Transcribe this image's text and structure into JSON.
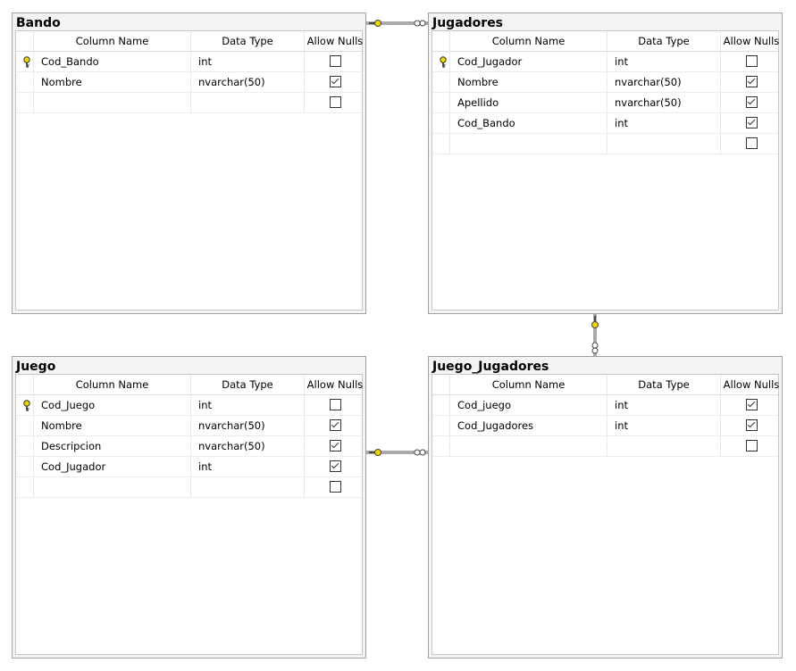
{
  "headers": {
    "col_name": "Column Name",
    "data_type": "Data Type",
    "allow_nulls": "Allow Nulls"
  },
  "tables": [
    {
      "title": "Bando",
      "rows": [
        {
          "pk": true,
          "name": "Cod_Bando",
          "type": "int",
          "nulls": false
        },
        {
          "pk": false,
          "name": "Nombre",
          "type": "nvarchar(50)",
          "nulls": true
        },
        {
          "pk": false,
          "name": "",
          "type": "",
          "nulls": false
        }
      ]
    },
    {
      "title": "Jugadores",
      "rows": [
        {
          "pk": true,
          "name": "Cod_Jugador",
          "type": "int",
          "nulls": false
        },
        {
          "pk": false,
          "name": "Nombre",
          "type": "nvarchar(50)",
          "nulls": true
        },
        {
          "pk": false,
          "name": "Apellido",
          "type": "nvarchar(50)",
          "nulls": true
        },
        {
          "pk": false,
          "name": "Cod_Bando",
          "type": "int",
          "nulls": true
        },
        {
          "pk": false,
          "name": "",
          "type": "",
          "nulls": false
        }
      ]
    },
    {
      "title": "Juego",
      "rows": [
        {
          "pk": true,
          "name": "Cod_Juego",
          "type": "int",
          "nulls": false
        },
        {
          "pk": false,
          "name": "Nombre",
          "type": "nvarchar(50)",
          "nulls": true
        },
        {
          "pk": false,
          "name": "Descripcion",
          "type": "nvarchar(50)",
          "nulls": true
        },
        {
          "pk": false,
          "name": "Cod_Jugador",
          "type": "int",
          "nulls": true
        },
        {
          "pk": false,
          "name": "",
          "type": "",
          "nulls": false
        }
      ]
    },
    {
      "title": "Juego_Jugadores",
      "rows": [
        {
          "pk": false,
          "name": "Cod_juego",
          "type": "int",
          "nulls": true
        },
        {
          "pk": false,
          "name": "Cod_Jugadores",
          "type": "int",
          "nulls": true
        },
        {
          "pk": false,
          "name": "",
          "type": "",
          "nulls": false
        }
      ]
    }
  ],
  "relationships": [
    {
      "from": "Bando",
      "to": "Jugadores",
      "kind": "one-to-many"
    },
    {
      "from": "Jugadores",
      "to": "Juego_Jugadores",
      "kind": "one-to-many"
    },
    {
      "from": "Juego",
      "to": "Juego_Jugadores",
      "kind": "one-to-many"
    }
  ],
  "colors": {
    "key_icon": "#f2d400",
    "connector": "#555555",
    "frame": "#a0a0a0"
  }
}
